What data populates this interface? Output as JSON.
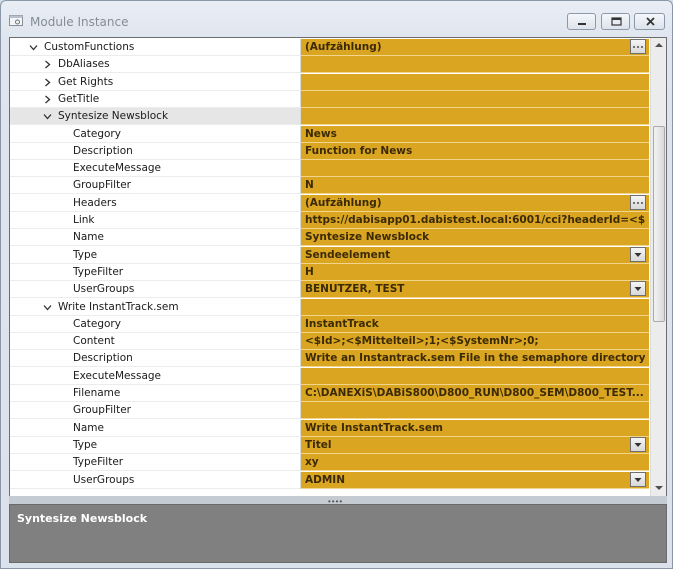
{
  "window": {
    "title": "Module Instance"
  },
  "grid": {
    "rows": [
      {
        "label": "CustomFunctions",
        "value": "(Aufzählung)",
        "button": "ellipsis",
        "expander": "expanded"
      },
      {
        "label": "DbAliases",
        "value": "",
        "expander": "collapsed"
      },
      {
        "label": "Get Rights",
        "value": "",
        "expander": "collapsed"
      },
      {
        "label": "GetTitle",
        "value": "",
        "expander": "collapsed"
      },
      {
        "label": "Syntesize Newsblock",
        "value": "",
        "expander": "expanded",
        "selected": true
      },
      {
        "label": "Category",
        "value": "News"
      },
      {
        "label": "Description",
        "value": "Function for News"
      },
      {
        "label": "ExecuteMessage",
        "value": ""
      },
      {
        "label": "GroupFilter",
        "value": "N"
      },
      {
        "label": "Headers",
        "value": "(Aufzählung)",
        "button": "ellipsis"
      },
      {
        "label": "Link",
        "value": "https://dabisapp01.dabistest.local:6001/cci?headerId=<$..."
      },
      {
        "label": "Name",
        "value": "Syntesize Newsblock"
      },
      {
        "label": "Type",
        "value": "Sendeelement",
        "button": "dropdown"
      },
      {
        "label": "TypeFilter",
        "value": "H"
      },
      {
        "label": "UserGroups",
        "value": "BENUTZER, TEST",
        "button": "dropdown"
      },
      {
        "label": "Write InstantTrack.sem",
        "value": "",
        "expander": "expanded"
      },
      {
        "label": "Category",
        "value": "InstantTrack"
      },
      {
        "label": "Content",
        "value": "<$Id>;<$Mittelteil>;1;<$SystemNr>;0;"
      },
      {
        "label": "Description",
        "value": "Write an Instantrack.sem File in the semaphore directory"
      },
      {
        "label": "ExecuteMessage",
        "value": ""
      },
      {
        "label": "Filename",
        "value": "C:\\DANEXiS\\DABiS800\\D800_RUN\\D800_SEM\\D800_TEST..."
      },
      {
        "label": "GroupFilter",
        "value": ""
      },
      {
        "label": "Name",
        "value": "Write InstantTrack.sem"
      },
      {
        "label": "Type",
        "value": "Titel",
        "button": "dropdown"
      },
      {
        "label": "TypeFilter",
        "value": "xy"
      },
      {
        "label": "UserGroups",
        "value": "ADMIN",
        "button": "dropdown"
      }
    ]
  },
  "description_pane": {
    "title": "Syntesize Newsblock"
  },
  "colors": {
    "value_background": "#daa520",
    "selected_row": "#e6e6e6",
    "description_background": "#808080"
  }
}
